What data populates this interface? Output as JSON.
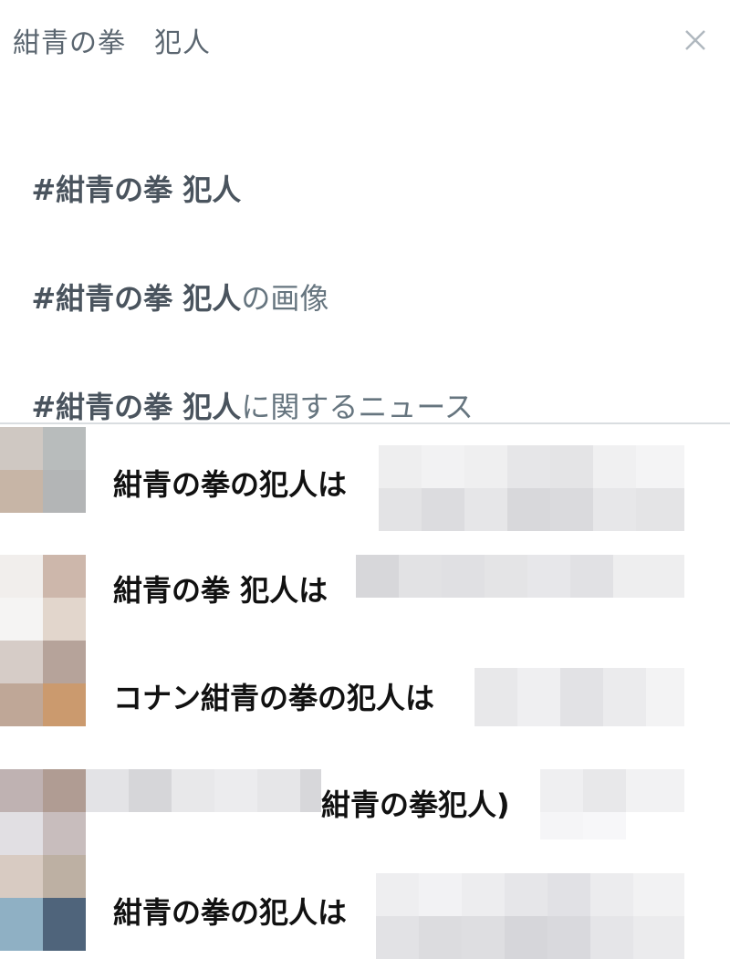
{
  "search": {
    "query": "紺青の拳　犯人",
    "clear_icon": "close-icon"
  },
  "suggestions": [
    {
      "query": "#紺青の拳 犯人",
      "suffix": ""
    },
    {
      "query": "#紺青の拳 犯人",
      "suffix": "の画像"
    },
    {
      "query": "#紺青の拳 犯人",
      "suffix": "に関するニュース"
    }
  ],
  "results": [
    {
      "text": "紺青の拳の犯人は"
    },
    {
      "text": "紺青の拳 犯人は"
    },
    {
      "text": "コナン紺青の拳の犯人は"
    },
    {
      "text": "紺青の拳犯人)"
    },
    {
      "text": "紺青の拳の犯人は"
    }
  ]
}
